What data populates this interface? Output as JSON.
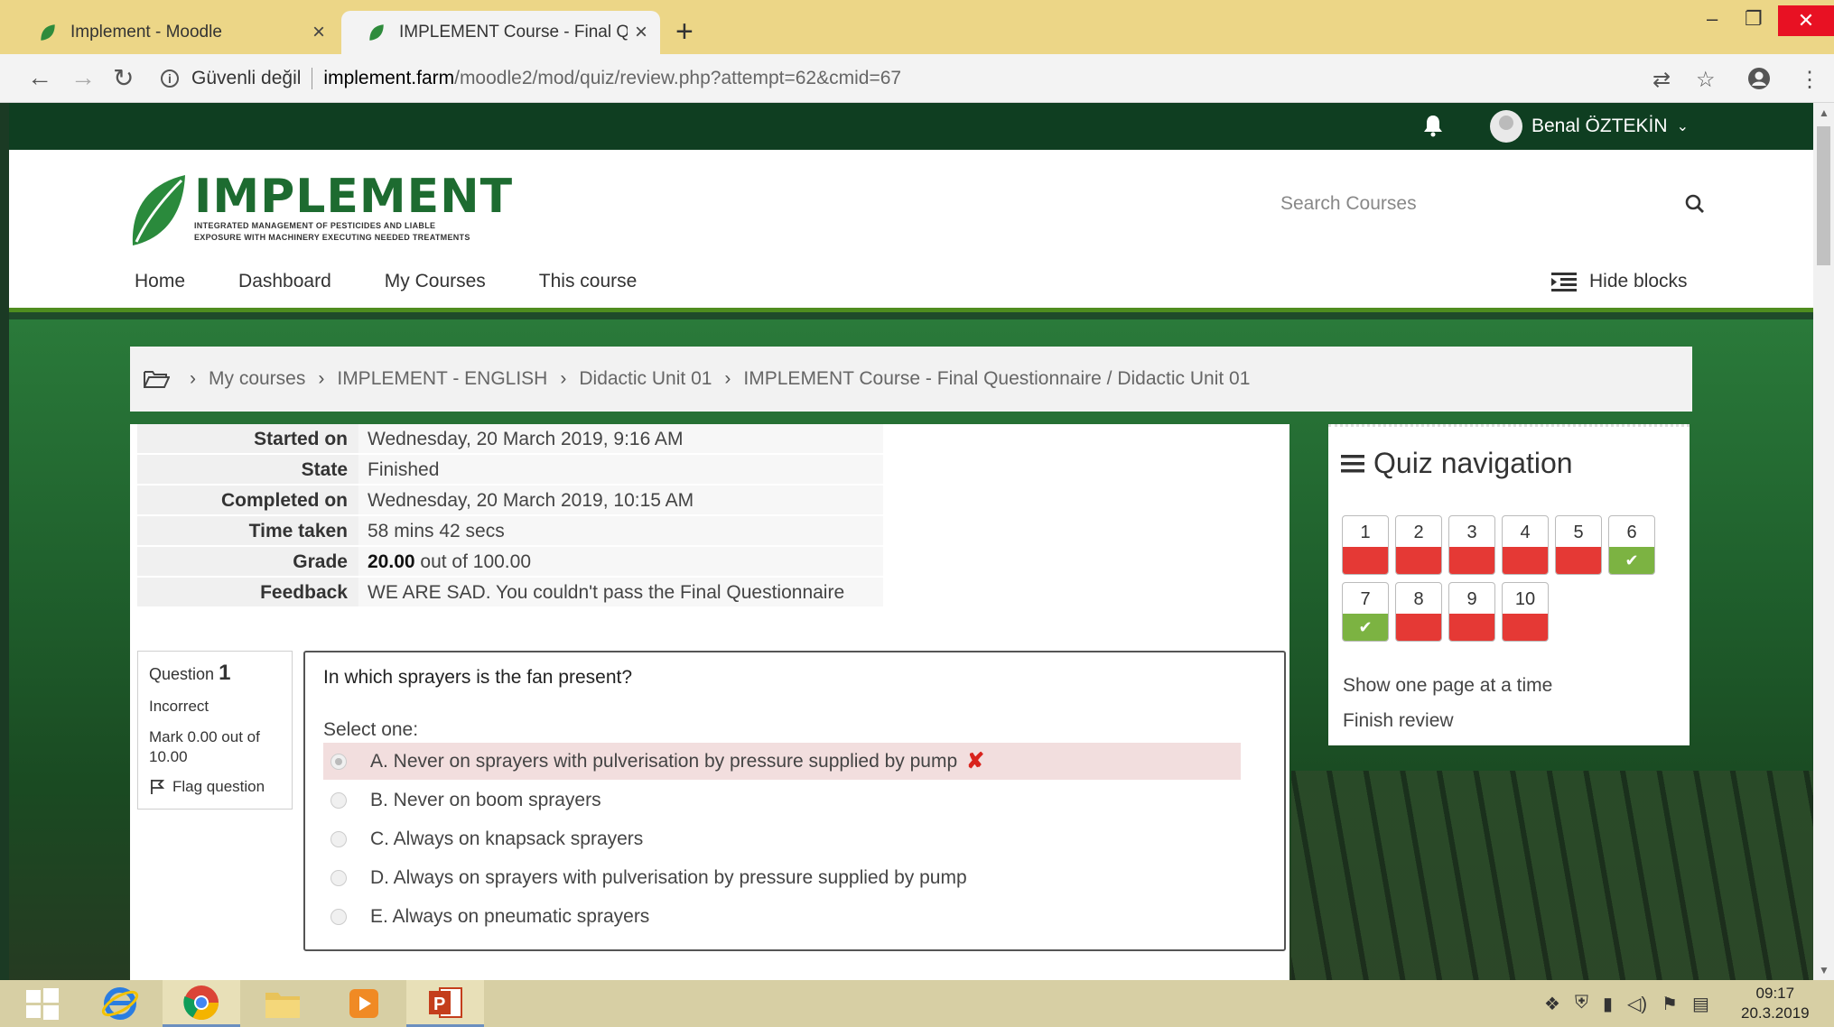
{
  "browser": {
    "tabs": [
      {
        "title": "Implement - Moodle"
      },
      {
        "title": "IMPLEMENT Course - Final Quest"
      }
    ],
    "address": {
      "security": "Güvenli değil",
      "host": "implement.farm",
      "path": "/moodle2/mod/quiz/review.php?attempt=62&cmid=67"
    }
  },
  "topnav": {
    "user_name": "Benal ÖZTEKİN"
  },
  "header": {
    "logo_word": "IMPLEMENT",
    "logo_sub1": "INTEGRATED MANAGEMENT OF PESTICIDES AND LIABLE",
    "logo_sub2": "EXPOSURE WITH MACHINERY EXECUTING NEEDED TREATMENTS",
    "search_placeholder": "Search Courses",
    "menu": [
      "Home",
      "Dashboard",
      "My Courses",
      "This course"
    ],
    "hide_blocks": "Hide blocks"
  },
  "breadcrumb": [
    "My courses",
    "IMPLEMENT - ENGLISH",
    "Didactic Unit 01",
    "IMPLEMENT Course - Final Questionnaire / Didactic Unit 01"
  ],
  "summary": {
    "started_on": {
      "label": "Started on",
      "value": "Wednesday, 20 March 2019, 9:16 AM"
    },
    "state": {
      "label": "State",
      "value": "Finished"
    },
    "completed_on": {
      "label": "Completed on",
      "value": "Wednesday, 20 March 2019, 10:15 AM"
    },
    "time_taken": {
      "label": "Time taken",
      "value": "58 mins 42 secs"
    },
    "grade": {
      "label": "Grade",
      "value_bold": "20.00",
      "value_rest": " out of 100.00"
    },
    "feedback": {
      "label": "Feedback",
      "value": "WE ARE SAD. You couldn't pass the Final Questionnaire"
    }
  },
  "question": {
    "label": "Question",
    "number": "1",
    "status": "Incorrect",
    "mark": "Mark 0.00 out of 10.00",
    "flag": "Flag question",
    "text": "In which sprayers is the fan present?",
    "select_one": "Select one:",
    "options": [
      "A. Never on sprayers with pulverisation by pressure supplied by pump",
      "B. Never on boom sprayers",
      "C. Always on knapsack sprayers",
      "D. Always on sprayers with pulverisation by pressure supplied by pump",
      "E. Always on pneumatic sprayers"
    ],
    "selected_index": 0
  },
  "quiz_nav": {
    "title": "Quiz navigation",
    "buttons": [
      {
        "n": "1",
        "status": "incorrect"
      },
      {
        "n": "2",
        "status": "incorrect"
      },
      {
        "n": "3",
        "status": "incorrect"
      },
      {
        "n": "4",
        "status": "incorrect"
      },
      {
        "n": "5",
        "status": "incorrect"
      },
      {
        "n": "6",
        "status": "correct"
      },
      {
        "n": "7",
        "status": "correct"
      },
      {
        "n": "8",
        "status": "incorrect"
      },
      {
        "n": "9",
        "status": "incorrect"
      },
      {
        "n": "10",
        "status": "incorrect"
      }
    ],
    "show_one_page": "Show one page at a time",
    "finish_review": "Finish review"
  },
  "taskbar": {
    "time": "09:17",
    "date": "20.3.2019"
  },
  "colors": {
    "brand_green": "#1d6b30",
    "topnav": "#0f3e21",
    "incorrect": "#e53935",
    "correct": "#7cb342",
    "wrong_answer_bg": "#f2dede"
  }
}
